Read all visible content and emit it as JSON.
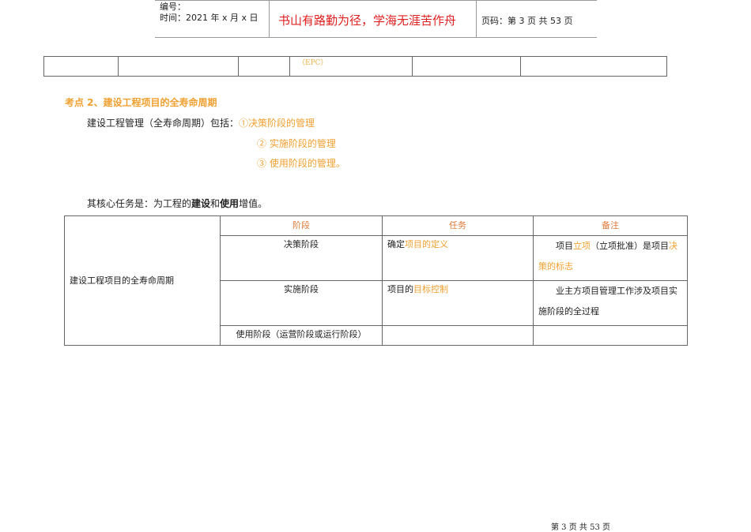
{
  "header": {
    "number_label": "编号：",
    "date_label": "时间：2021 年 x 月 x 日",
    "motto": "书山有路勤为径，学海无涯苦作舟",
    "page_label": "页码：第 3 页  共 53 页"
  },
  "top_table": {
    "cells": [
      "",
      "",
      "",
      "（EPC）",
      "",
      ""
    ]
  },
  "section": {
    "title": "考点 2、建设工程项目的全寿命周期",
    "intro": "建设工程管理（全寿命周期）包括：",
    "items": [
      "①决策阶段的管理",
      "② 实施阶段的管理",
      "③ 使用阶段的管理。"
    ],
    "core_prefix": "其核心任务是：为工程的",
    "core_b1": "建设",
    "core_mid": "和",
    "core_b2": "使用",
    "core_suffix": "增值。"
  },
  "table": {
    "row_header": "建设工程项目的全寿命周期",
    "columns": [
      "阶段",
      "任务",
      "备注"
    ],
    "rows": [
      {
        "stage": "决策阶段",
        "task_pre": "确定",
        "task_hl": "项目的定义",
        "note_pre": "项目",
        "note_hl": "立项",
        "note_mid": "（立项批准）是项目",
        "note_hl2": "决策的标志"
      },
      {
        "stage": "实施阶段",
        "task_pre": "项目的",
        "task_hl": "目标控制",
        "note": "业主方项目管理工作涉及项目实施阶段的全过程"
      },
      {
        "stage": "使用阶段（运营阶段或运行阶段）"
      }
    ]
  },
  "footer": {
    "page": "第 3 页 共 53 页"
  }
}
